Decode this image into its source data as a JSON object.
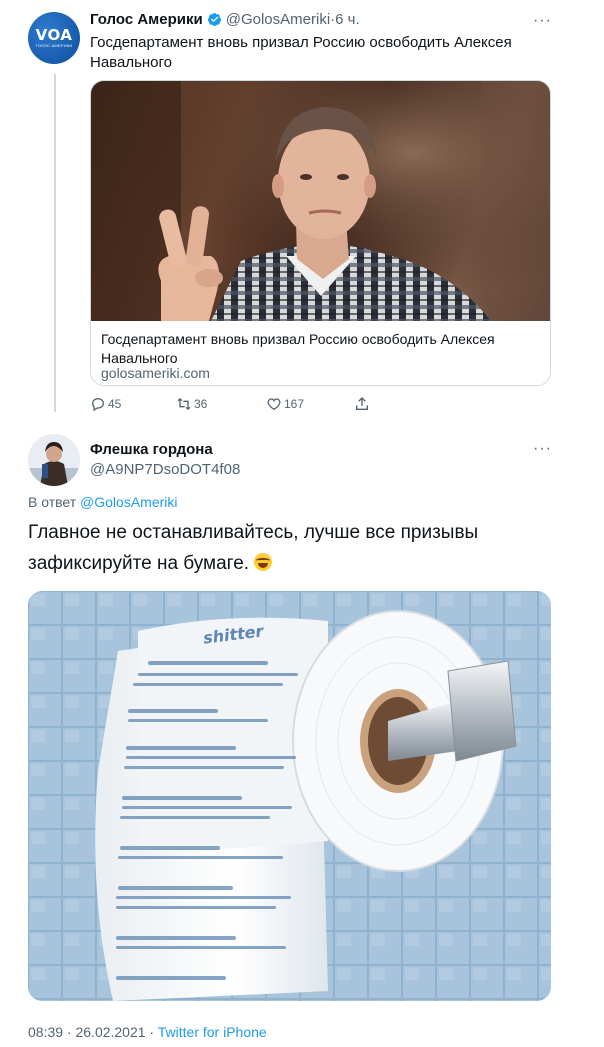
{
  "tweet1": {
    "display_name": "Голос Америки",
    "handle": "@GolosAmeriki",
    "separator": "·",
    "time": "6 ч.",
    "text": "Госдепартамент вновь призвал Россию освободить Алексея Навального",
    "avatar_text": "VOA",
    "avatar_subtext": "ГОЛОС АМЕРИКИ",
    "card": {
      "title": "Госдепартамент вновь призвал Россию освободить Алексея Навального",
      "domain": "golosameriki.com"
    },
    "actions": {
      "reply_count": "45",
      "retweet_count": "36",
      "like_count": "167"
    }
  },
  "tweet2": {
    "display_name": "Флешка гордона",
    "handle": "@A9NP7DsoDOT4f08",
    "reply_prefix": "В ответ",
    "reply_mention": "@GolosAmeriki",
    "text": "Главное не останавливайтесь, лучше все призывы зафиксируйте на бумаге.",
    "photo_brand": "shitter",
    "footer": {
      "timestamp": "08:39 · 26.02.2021 ·",
      "source": "Twitter for iPhone"
    }
  },
  "icons": {
    "verified": "verified-badge-icon",
    "more": "more-options-icon",
    "reply": "reply-icon",
    "retweet": "retweet-icon",
    "like": "like-icon",
    "share": "share-icon"
  },
  "colors": {
    "link": "#1d9bf0",
    "secondary_text": "#536471",
    "border": "#cfd9de",
    "avatar_blue": "#0d4d9c"
  }
}
